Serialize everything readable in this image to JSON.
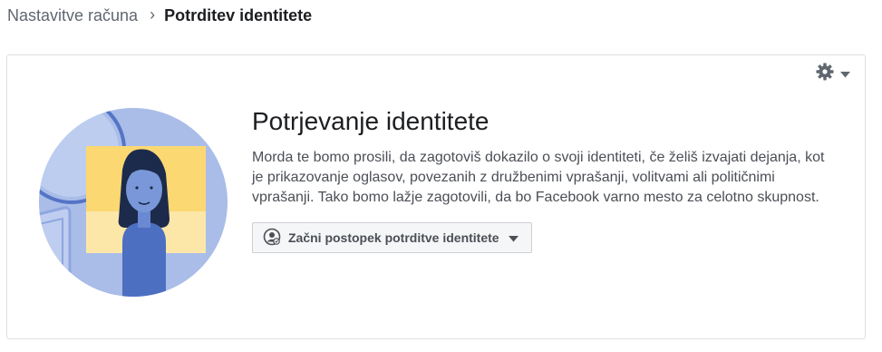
{
  "breadcrumb": {
    "root": "Nastavitve računa",
    "separator": "›",
    "current": "Potrditev identitete"
  },
  "card": {
    "settings_icon": "gear-icon",
    "dropdown_icon": "caret-down-icon",
    "title": "Potrjevanje identitete",
    "description": "Morda te bomo prosili, da zagotoviš dokazilo o svoji identiteti, če želiš izvajati dejanja, kot je prikazovanje oglasov, povezanih z družbenimi vprašanji, volitvami ali političnimi vprašanji. Tako bomo lažje zagotovili, da bo Facebook varno mesto za celotno skupnost.",
    "action_button": {
      "icon": "identity-badge-icon",
      "label": "Začni postopek potrditve identitete",
      "caret": "caret-down-icon"
    }
  },
  "colors": {
    "circle": "#a9bde8",
    "circle_line": "#5474c5",
    "card_yellow": "#fcd872",
    "card_light": "#fde7a8",
    "person_hair": "#1c2b4b",
    "person_face": "#7a98d9",
    "person_body": "#4d6fc2",
    "icon_gray": "#606770"
  }
}
